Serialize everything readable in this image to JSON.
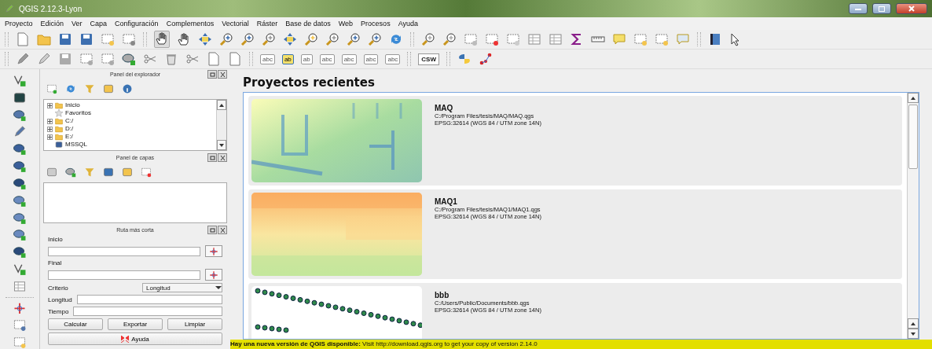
{
  "window": {
    "title": "QGIS 2.12.3-Lyon"
  },
  "menu": [
    "Proyecto",
    "Edición",
    "Ver",
    "Capa",
    "Configuración",
    "Complementos",
    "Vectorial",
    "Ráster",
    "Base de datos",
    "Web",
    "Procesos",
    "Ayuda"
  ],
  "label_toolbar": {
    "labels": [
      {
        "text": "abc",
        "selected": false
      },
      {
        "text": "ab",
        "selected": true
      },
      {
        "text": "ab",
        "selected": false
      },
      {
        "text": "abc",
        "selected": false
      },
      {
        "text": "abc",
        "selected": false
      },
      {
        "text": "abc",
        "selected": false
      },
      {
        "text": "abc",
        "selected": false
      }
    ],
    "csw": "CSW"
  },
  "browser_panel": {
    "title": "Panel del explorador",
    "tree": [
      {
        "label": "Inicio",
        "kind": "folder",
        "expandable": true
      },
      {
        "label": "Favoritos",
        "kind": "star",
        "expandable": false
      },
      {
        "label": "C:/",
        "kind": "folder",
        "expandable": true
      },
      {
        "label": "D:/",
        "kind": "folder",
        "expandable": true
      },
      {
        "label": "E:/",
        "kind": "folder",
        "expandable": true
      },
      {
        "label": "MSSQL",
        "kind": "database",
        "expandable": false
      }
    ]
  },
  "layers_panel": {
    "title": "Panel de capas"
  },
  "route_panel": {
    "title": "Ruta más corta",
    "start_label": "Inicio",
    "end_label": "Final",
    "criterion_label": "Criterio",
    "criterion_value": "Longitud",
    "length_label": "Longitud",
    "time_label": "Tiempo",
    "buttons": [
      "Calcular",
      "Exportar",
      "Limpiar"
    ],
    "help_button": "Ayuda"
  },
  "recent": {
    "title": "Proyectos recientes",
    "projects": [
      {
        "name": "MAQ",
        "path": "C:/Program Files/tesis/MAQ/MAQ.qgs",
        "crs": "EPSG:32614 (WGS 84 / UTM zone 14N)"
      },
      {
        "name": "MAQ1",
        "path": "C:/Program Files/tesis/MAQ1/MAQ1.qgs",
        "crs": "EPSG:32614 (WGS 84 / UTM zone 14N)"
      },
      {
        "name": "bbb",
        "path": "C:/Users/Public/Documents/bbb.qgs",
        "crs": "EPSG:32614 (WGS 84 / UTM zone 14N)"
      }
    ]
  },
  "status_bar": "**Hay una nueva versión de QGIS disponible:** Visit http://download.qgis.org to get your copy of version 2.14.0"
}
